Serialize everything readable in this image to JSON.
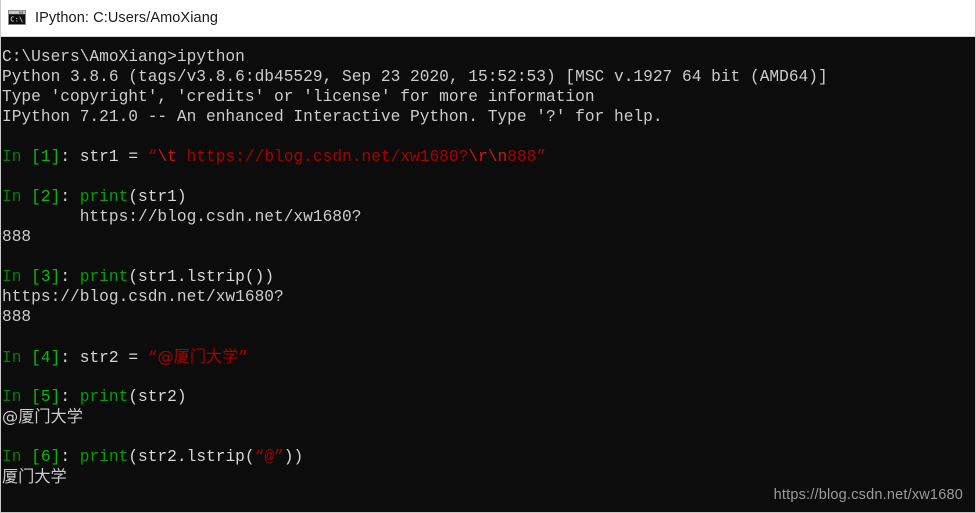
{
  "window": {
    "title": "IPython: C:Users/AmoXiang",
    "icon": "cmd-console-icon",
    "titlebar_bg": "#ffffff",
    "console_bg": "#0c0c0c"
  },
  "colors": {
    "prompt_in": "#008000",
    "prompt_number": "#00bf00",
    "code_default": "#d6d6d6",
    "builtin": "#00a000",
    "string": "#a80000",
    "escape": "#d41414",
    "output": "#cccccc",
    "watermark": "#9b9b9b"
  },
  "console": {
    "header": [
      "C:\\Users\\AmoXiang>ipython",
      "Python 3.8.6 (tags/v3.8.6:db45529, Sep 23 2020, 15:52:53) [MSC v.1927 64 bit (AMD64)]",
      "Type 'copyright', 'credits' or 'license' for more information",
      "IPython 7.21.0 -- An enhanced Interactive Python. Type '?' for help."
    ],
    "cells": [
      {
        "prompt_in": "In",
        "prompt_num": "[1]",
        "prompt_colon": ":",
        "code_pre": " str1 = ",
        "quote_open": "“",
        "str_escape1": "\\t",
        "str_body": " https://blog.csdn.net/xw1680?",
        "str_escape2": "\\r\\n",
        "str_tail": "888",
        "quote_close": "”",
        "output": []
      },
      {
        "prompt_in": "In",
        "prompt_num": "[2]",
        "prompt_colon": ":",
        "builtin": " print",
        "code_post": "(str1)",
        "output": [
          "        https://blog.csdn.net/xw1680?",
          "888"
        ]
      },
      {
        "prompt_in": "In",
        "prompt_num": "[3]",
        "prompt_colon": ":",
        "builtin": " print",
        "code_post": "(str1.lstrip())",
        "output": [
          "https://blog.csdn.net/xw1680?",
          "888"
        ]
      },
      {
        "prompt_in": "In",
        "prompt_num": "[4]",
        "prompt_colon": ":",
        "code_pre": " str2 = ",
        "quote_open": "“",
        "str_body": "@厦门大学",
        "quote_close": "”",
        "output": []
      },
      {
        "prompt_in": "In",
        "prompt_num": "[5]",
        "prompt_colon": ":",
        "builtin": " print",
        "code_post": "(str2)",
        "output": [
          "@厦门大学"
        ]
      },
      {
        "prompt_in": "In",
        "prompt_num": "[6]",
        "prompt_colon": ":",
        "builtin": " print",
        "code_post_a": "(str2.lstrip(",
        "quote_open": "“",
        "str_body": "@",
        "quote_close": "”",
        "code_post_b": "))",
        "output": [
          "厦门大学"
        ]
      }
    ]
  },
  "watermark": {
    "text": "https://blog.csdn.net/xw1680"
  }
}
